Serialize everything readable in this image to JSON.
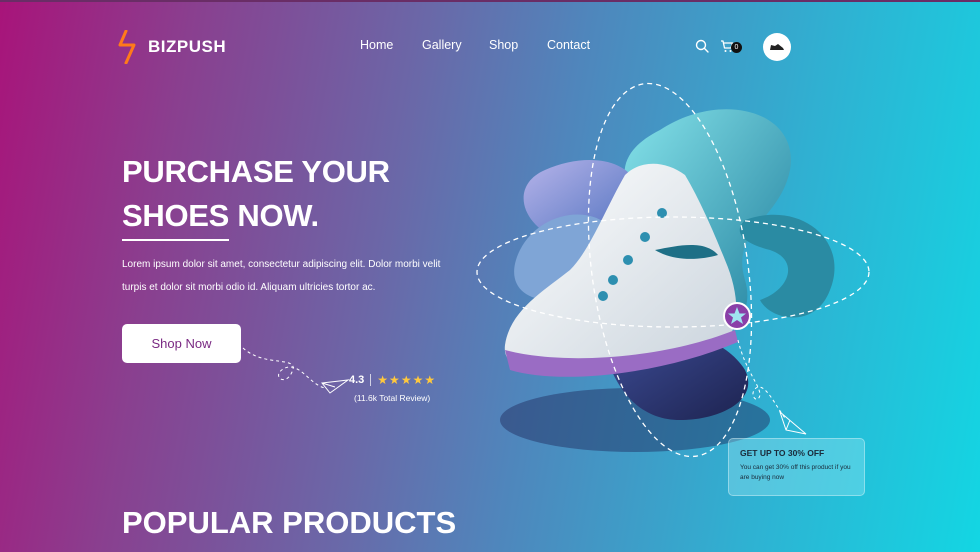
{
  "brand": {
    "name": "BIZPUSH",
    "logo_icon": "lightning-bolt-icon",
    "accent": "#ff7a1a"
  },
  "nav": {
    "items": [
      "Home",
      "Gallery",
      "Shop",
      "Contact"
    ]
  },
  "header_icons": {
    "search": "search-icon",
    "cart": "cart-icon",
    "cart_count": "0",
    "avatar": "shoe-avatar-icon"
  },
  "hero": {
    "title_line1": "PURCHASE YOUR",
    "title_word_underlined": "SHOES",
    "title_word_rest": "NOW.",
    "description": "Lorem ipsum dolor sit amet, consectetur adipiscing elit. Dolor morbi velit turpis et dolor sit morbi odio id. Aliquam ultricies tortor ac.",
    "cta_label": "Shop Now"
  },
  "rating": {
    "value": "4.3",
    "stars": 5,
    "stars_glyph": "★★★★★",
    "count_text": "(11.6k Total Review)",
    "star_color": "#ffc83d"
  },
  "promo": {
    "title": "GET UP TO 30% OFF",
    "text": "You can get 30% off this product if you are buying now"
  },
  "section": {
    "title": "POPULAR PRODUCTS"
  },
  "colors": {
    "gradient_start": "#a8147a",
    "gradient_end": "#13d6e3",
    "button_text": "#7a2a83"
  }
}
